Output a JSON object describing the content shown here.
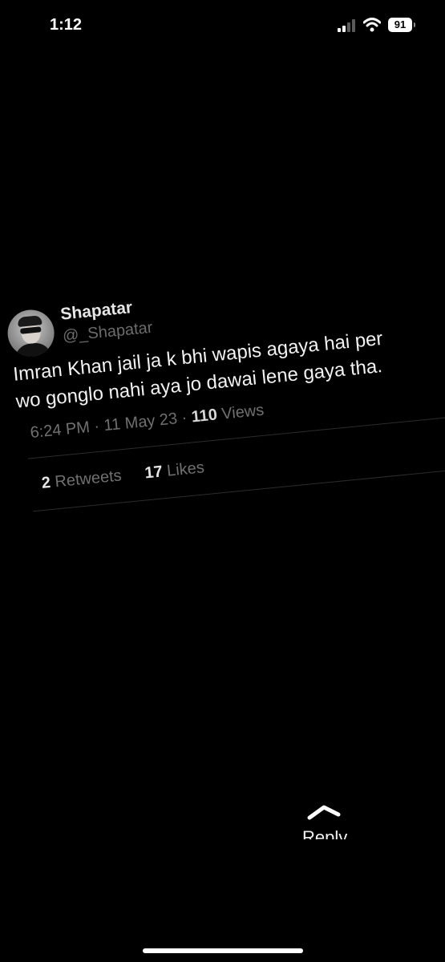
{
  "status_bar": {
    "time": "1:12",
    "battery": "91",
    "signal_icon": "cellular-signal-icon",
    "wifi_icon": "wifi-icon"
  },
  "tweet": {
    "display_name": "Shapatar",
    "handle": "@_Shapatar",
    "text_line1": "Imran Khan jail ja k bhi wapis agaya hai per",
    "text_line2": "wo gonglo nahi aya jo dawai lene gaya tha.",
    "time": "6:24 PM",
    "date": "11 May 23",
    "views_count": "110",
    "views_label": "Views",
    "retweets_count": "2",
    "retweets_label": "Retweets",
    "likes_count": "17",
    "likes_label": "Likes"
  },
  "reply": {
    "label": "Reply",
    "icon": "swipe-up-caret-icon"
  },
  "colors": {
    "background": "#000000",
    "text_primary": "#f2f2f2",
    "text_secondary": "#707070"
  }
}
